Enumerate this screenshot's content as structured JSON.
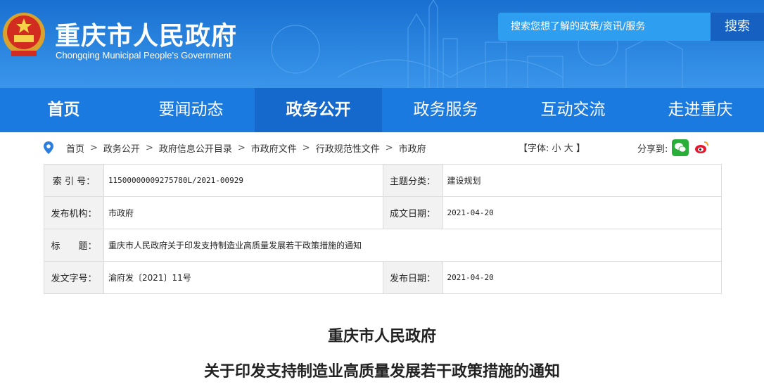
{
  "header": {
    "title": "重庆市人民政府",
    "subtitle": "Chongqing Municipal People's Government",
    "search_placeholder": "搜索您想了解的政策/资讯/服务",
    "search_button": "搜索"
  },
  "nav": [
    {
      "label": "首页"
    },
    {
      "label": "要闻动态"
    },
    {
      "label": "政务公开"
    },
    {
      "label": "政务服务"
    },
    {
      "label": "互动交流"
    },
    {
      "label": "走进重庆"
    }
  ],
  "breadcrumb": [
    "首页",
    "政务公开",
    "政府信息公开目录",
    "市政府文件",
    "行政规范性文件",
    "市政府"
  ],
  "breadcrumb_sep": ">",
  "font_size": {
    "label": "【字体:",
    "small": "小",
    "large": "大",
    "close": "】"
  },
  "share": {
    "label": "分享到:"
  },
  "meta": {
    "index_label": "索 引 号：",
    "index_value": "11500000009275780L/2021-00929",
    "subject_label": "主题分类：",
    "subject_value": "建设规划",
    "issuer_label": "发布机构：",
    "issuer_value": "市政府",
    "created_label": "成文日期：",
    "created_value": "2021-04-20",
    "title_label": "标　　题：",
    "title_value": "重庆市人民政府关于印发支持制造业高质量发展若干政策措施的通知",
    "docno_label": "发文字号：",
    "docno_value": "渝府发〔2021〕11号",
    "published_label": "发布日期：",
    "published_value": "2021-04-20"
  },
  "document": {
    "heading1": "重庆市人民政府",
    "heading2": "关于印发支持制造业高质量发展若干政策措施的通知"
  },
  "colors": {
    "header_blue": "#1a6fd0",
    "nav_blue": "#1b7ae0",
    "nav_active": "#1569cc",
    "search_btn": "#1560c0"
  }
}
